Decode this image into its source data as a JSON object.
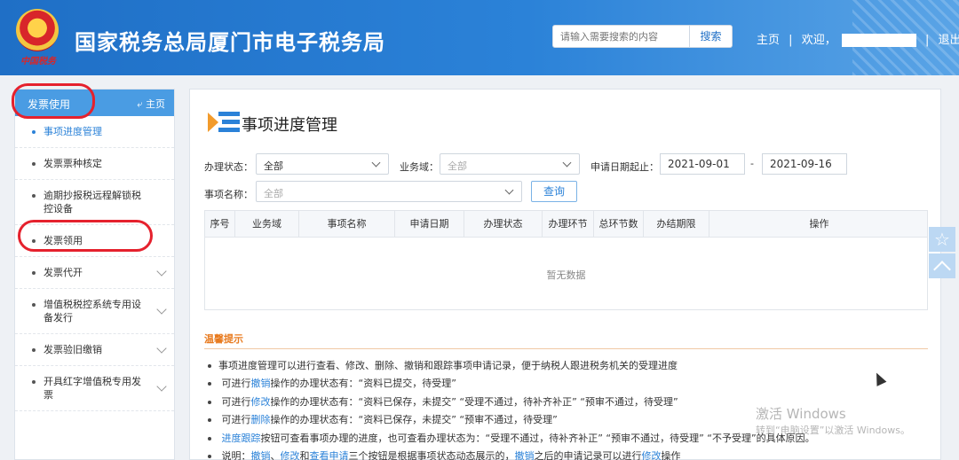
{
  "header": {
    "title": "国家税务总局厦门市电子税务局",
    "emblem_text": "中国税务",
    "search_placeholder": "请输入需要搜索的内容",
    "search_button": "搜索",
    "nav_home": "主页",
    "nav_sep1": "|",
    "nav_welcome": "欢迎，",
    "nav_sep2": "|",
    "nav_logout": "退出"
  },
  "sidebar": {
    "title": "发票使用",
    "home_label": "主页",
    "items": [
      {
        "label": "事项进度管理"
      },
      {
        "label": "发票票种核定"
      },
      {
        "label": "逾期抄报税远程解锁税控设备"
      },
      {
        "label": "发票领用"
      },
      {
        "label": "发票代开"
      },
      {
        "label": "增值税税控系统专用设备发行"
      },
      {
        "label": "发票验旧缴销"
      },
      {
        "label": "开具红字增值税专用发票"
      }
    ]
  },
  "main": {
    "title": "事项进度管理",
    "filters": {
      "status_label": "办理状态：",
      "status_value": "全部",
      "domain_label": "业务域：",
      "domain_placeholder": "全部",
      "date_label": "申请日期起止：",
      "date_start": "2021-09-01",
      "date_sep": "-",
      "date_end": "2021-09-16",
      "name_label": "事项名称：",
      "name_placeholder": "全部",
      "query_button": "查询"
    },
    "table": {
      "columns": [
        "序号",
        "业务域",
        "事项名称",
        "申请日期",
        "办理状态",
        "办理环节",
        "总环节数",
        "办结期限",
        "操作"
      ],
      "empty_text": "暂无数据"
    },
    "tips": {
      "title": "温馨提示",
      "line1": "事项进度管理可以进行查看、修改、删除、撤销和跟踪事项申请记录，便于纳税人跟进税务机关的受理进度",
      "line2_a": "可进行",
      "line2_link": "撤销",
      "line2_b": "操作的办理状态有：“资料已提交，待受理”",
      "line3_a": "可进行",
      "line3_link": "修改",
      "line3_b": "操作的办理状态有：“资料已保存，未提交” “受理不通过，待补齐补正” “预审不通过，待受理”",
      "line4_a": "可进行",
      "line4_link": "删除",
      "line4_b": "操作的办理状态有：“资料已保存，未提交” “预审不通过，待受理”",
      "line5_link": "进度跟踪",
      "line5_b": "按钮可查看事项办理的进度，也可查看办理状态为：“受理不通过，待补齐补正” “预审不通过，待受理” “不予受理”的具体原因。",
      "line6_a": "说明：",
      "line6_l1": "撤销",
      "line6_s1": "、",
      "line6_l2": "修改",
      "line6_s2": "和",
      "line6_l3": "查看申请",
      "line6_b": "三个按钮是根据事项状态动态展示的，",
      "line6_l4": "撤销",
      "line6_c": "之后的申请记录可以进行",
      "line6_l5": "修改",
      "line6_d": "操作"
    }
  },
  "watermark": {
    "line1": "激活 Windows",
    "line2": "转到“电脑设置”以激活 Windows。"
  },
  "icons": {
    "float_star": "☆"
  },
  "colors": {
    "header_blue": "#2b82d8",
    "sidebar_head": "#4a9ce3",
    "highlight_red": "#e5212d",
    "tips_orange": "#e87a1e"
  }
}
